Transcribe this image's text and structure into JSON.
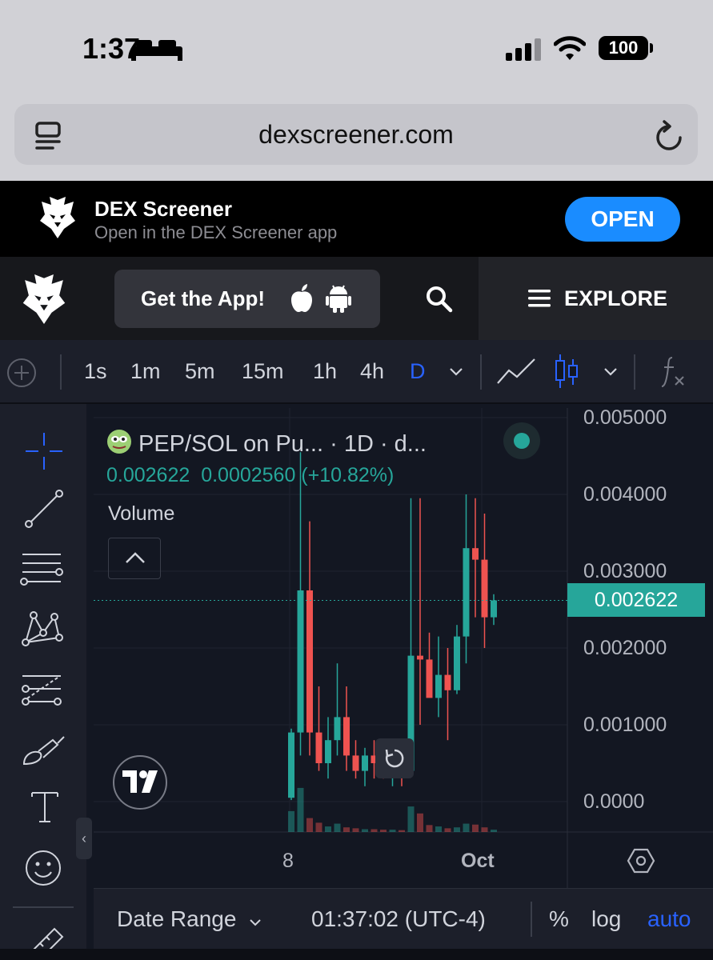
{
  "status_bar": {
    "time": "1:37",
    "battery": "100"
  },
  "browser": {
    "url": "dexscreener.com"
  },
  "app_banner": {
    "title": "DEX Screener",
    "subtitle": "Open in the DEX Screener app",
    "open_label": "OPEN"
  },
  "nav": {
    "get_app_label": "Get the App!",
    "explore_label": "EXPLORE"
  },
  "timeframes": {
    "items": [
      "1s",
      "1m",
      "5m",
      "15m",
      "1h",
      "4h",
      "D"
    ],
    "selected": "D"
  },
  "chart": {
    "pair_title": "PEP/SOL on Pu... · 1D · d...",
    "last_price": "0.002622",
    "change": "0.0002560 (+10.82%)",
    "volume_label": "Volume",
    "y_ticks": [
      "0.005000",
      "0.004000",
      "0.003000",
      "0.002000",
      "0.001000",
      "0.0000"
    ],
    "current_price_tag": "0.002622",
    "x_ticks": [
      "8",
      "Oct"
    ],
    "colors": {
      "up": "#26a69a",
      "down": "#ef5350",
      "background": "#131722"
    }
  },
  "chart_data": {
    "type": "candlestick",
    "ylim": [
      0,
      0.005
    ],
    "candles": [
      {
        "o": 5e-05,
        "h": 0.00095,
        "l": 2e-05,
        "c": 0.0009,
        "v": 0.45
      },
      {
        "o": 0.0009,
        "h": 0.00455,
        "l": 0.0006,
        "c": 0.00275,
        "v": 0.95
      },
      {
        "o": 0.00275,
        "h": 0.00365,
        "l": 0.0006,
        "c": 0.0009,
        "v": 0.3
      },
      {
        "o": 0.0009,
        "h": 0.0015,
        "l": 0.0004,
        "c": 0.0005,
        "v": 0.2
      },
      {
        "o": 0.0005,
        "h": 0.0011,
        "l": 0.0003,
        "c": 0.0008,
        "v": 0.12
      },
      {
        "o": 0.0008,
        "h": 0.0018,
        "l": 0.0006,
        "c": 0.0011,
        "v": 0.18
      },
      {
        "o": 0.0011,
        "h": 0.0015,
        "l": 0.0004,
        "c": 0.0006,
        "v": 0.1
      },
      {
        "o": 0.0006,
        "h": 0.0008,
        "l": 0.0003,
        "c": 0.0004,
        "v": 0.08
      },
      {
        "o": 0.0004,
        "h": 0.0007,
        "l": 0.0002,
        "c": 0.0006,
        "v": 0.06
      },
      {
        "o": 0.0006,
        "h": 0.0008,
        "l": 0.0003,
        "c": 0.0005,
        "v": 0.06
      },
      {
        "o": 0.0005,
        "h": 0.0007,
        "l": 0.0003,
        "c": 0.0004,
        "v": 0.05
      },
      {
        "o": 0.0004,
        "h": 0.0006,
        "l": 0.0002,
        "c": 0.0005,
        "v": 0.05
      },
      {
        "o": 0.0005,
        "h": 0.00065,
        "l": 0.0002,
        "c": 0.0004,
        "v": 0.04
      },
      {
        "o": 0.0004,
        "h": 0.00395,
        "l": 0.00035,
        "c": 0.0019,
        "v": 0.55
      },
      {
        "o": 0.0019,
        "h": 0.00395,
        "l": 0.001,
        "c": 0.00185,
        "v": 0.4
      },
      {
        "o": 0.00185,
        "h": 0.0022,
        "l": 0.0014,
        "c": 0.00135,
        "v": 0.15
      },
      {
        "o": 0.00135,
        "h": 0.00215,
        "l": 0.0011,
        "c": 0.00165,
        "v": 0.12
      },
      {
        "o": 0.00165,
        "h": 0.002,
        "l": 0.0008,
        "c": 0.00145,
        "v": 0.08
      },
      {
        "o": 0.00145,
        "h": 0.0023,
        "l": 0.0014,
        "c": 0.00215,
        "v": 0.1
      },
      {
        "o": 0.00215,
        "h": 0.004,
        "l": 0.0018,
        "c": 0.0033,
        "v": 0.18
      },
      {
        "o": 0.0033,
        "h": 0.00395,
        "l": 0.0024,
        "c": 0.00315,
        "v": 0.16
      },
      {
        "o": 0.00315,
        "h": 0.00375,
        "l": 0.002,
        "c": 0.0024,
        "v": 0.1
      },
      {
        "o": 0.0024,
        "h": 0.0027,
        "l": 0.0023,
        "c": 0.00262,
        "v": 0.05
      }
    ]
  },
  "bottom_bar": {
    "date_range": "Date Range",
    "clock": "01:37:02 (UTC-4)",
    "percent": "%",
    "log": "log",
    "auto": "auto"
  }
}
